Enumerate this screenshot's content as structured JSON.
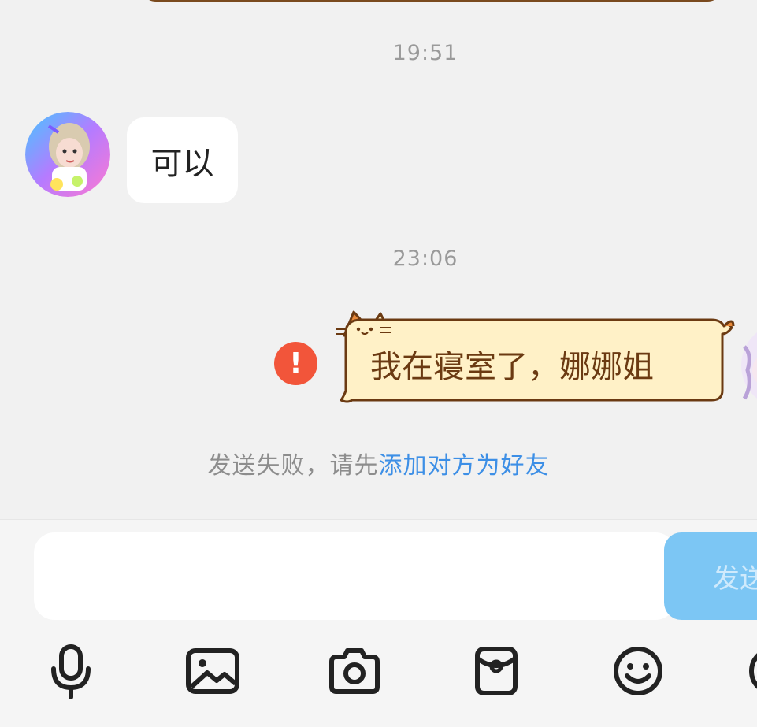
{
  "chat": {
    "timestamp_1": "19:51",
    "incoming_message": "可以",
    "timestamp_2": "23:06",
    "outgoing_message": "我在寝室了，娜娜姐",
    "error_mark": "!",
    "fail_notice_prefix": "发送失败，请先",
    "fail_notice_link": "添加对方为好友"
  },
  "composer": {
    "input_value": "",
    "send_label": "发送"
  },
  "toolbar": {
    "icons": [
      "microphone-icon",
      "image-icon",
      "camera-icon",
      "red-packet-icon",
      "emoji-icon",
      "more-icon"
    ]
  },
  "colors": {
    "background": "#f1f1f1",
    "bubble_theme_fill": "#fff1c7",
    "bubble_theme_border": "#7a4a1e",
    "error_red": "#f2553a",
    "link_blue": "#3d8fe6",
    "send_button": "#7cc6f4"
  }
}
